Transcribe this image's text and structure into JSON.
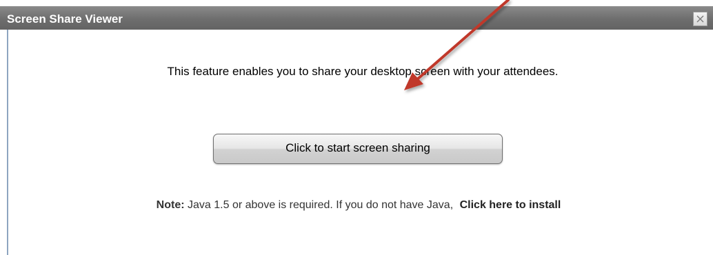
{
  "dialog": {
    "title": "Screen Share Viewer",
    "close_icon": "close-icon"
  },
  "main": {
    "message": "This feature enables you to share your desktop screen with your attendees.",
    "start_button_label": "Click to start screen sharing",
    "note_prefix": "Note:",
    "note_text": "Java 1.5 or above is required. If you do not have Java,",
    "install_link": "Click here to install"
  },
  "annotation": {
    "arrow_color": "#c0392b"
  }
}
